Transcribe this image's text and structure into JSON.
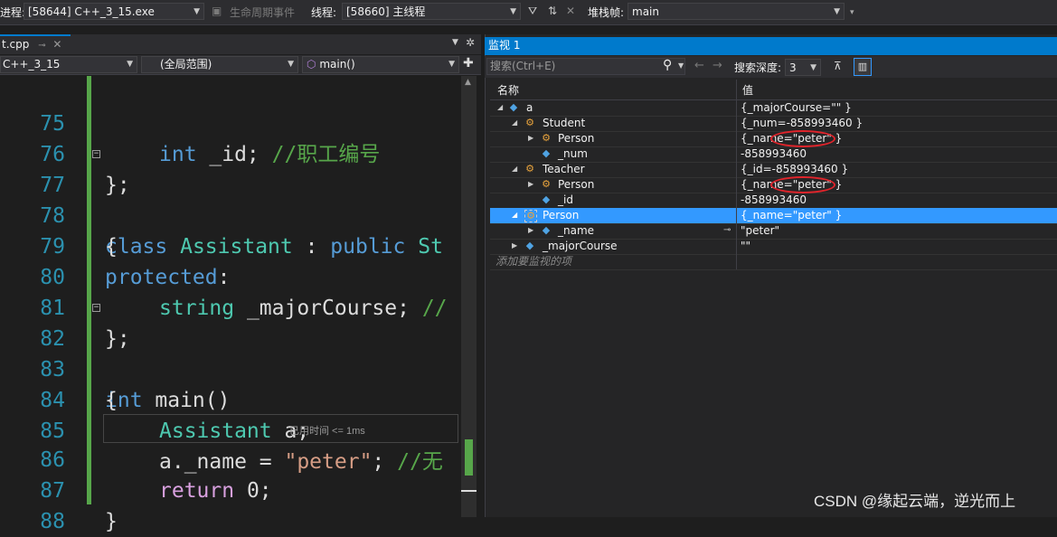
{
  "toolbar": {
    "process_label": "进程:",
    "process_value": "[58644] C++_3_15.exe",
    "lifecycle_label": "生命周期事件",
    "thread_label": "线程:",
    "thread_value": "[58660] 主线程",
    "stackframe_label": "堆栈帧:",
    "stackframe_value": "main"
  },
  "editor": {
    "tab_name": "t.cpp",
    "nav_project": "C++_3_15",
    "nav_scope": "(全局范围)",
    "nav_function": "main()",
    "perf_tip": "已用时间 <= 1ms",
    "lines": [
      {
        "num": "75"
      },
      {
        "num": "76"
      },
      {
        "num": "77"
      },
      {
        "num": "78"
      },
      {
        "num": "79"
      },
      {
        "num": "80"
      },
      {
        "num": "81"
      },
      {
        "num": "82"
      },
      {
        "num": "83"
      },
      {
        "num": "84"
      },
      {
        "num": "85"
      },
      {
        "num": "86"
      },
      {
        "num": "87"
      },
      {
        "num": "88"
      }
    ],
    "code": {
      "l75_kw": "int",
      "l75_text": " _id; ",
      "l75_comment": "//职工编号",
      "l76": "};",
      "l77_kw": "class",
      "l77_type": "Assistant",
      "l77_colon": " : ",
      "l77_public": "public",
      "l77_rest": "St",
      "l78": "{",
      "l79_kw": "protected",
      "l79_colon": ":",
      "l80_type": "string",
      "l80_text": " _majorCourse; ",
      "l80_comment": "//",
      "l81": "};",
      "l82_kw": "int",
      "l82_text": " main()",
      "l83": "{",
      "l84_type": "Assistant",
      "l84_text": " a;",
      "l85_text": "a._name = ",
      "l85_str": "\"peter\"",
      "l85_semi": "; ",
      "l85_comment": "//无",
      "l86_kw": "return",
      "l86_text": " 0;",
      "l87": "}"
    }
  },
  "watch": {
    "title": "监视 1",
    "search_placeholder": "搜索(Ctrl+E)",
    "depth_label": "搜索深度:",
    "depth_value": "3",
    "col_name": "名称",
    "col_value": "值",
    "rows": [
      {
        "name": "a",
        "value": "{_majorCourse=\"\" }"
      },
      {
        "name": "Student",
        "value": "{_num=-858993460 }"
      },
      {
        "name": "Person",
        "value": "{_name=\"peter\" }"
      },
      {
        "name": "_num",
        "value": "-858993460"
      },
      {
        "name": "Teacher",
        "value": "{_id=-858993460 }"
      },
      {
        "name": "Person",
        "value": "{_name=\"peter\" }"
      },
      {
        "name": "_id",
        "value": "-858993460"
      },
      {
        "name": "Person",
        "value": "{_name=\"peter\" }"
      },
      {
        "name": "_name",
        "value": "\"peter\""
      },
      {
        "name": "_majorCourse",
        "value": "\"\""
      }
    ],
    "add_watch": "添加要监视的项"
  },
  "watermark": "CSDN @缘起云端，逆光而上",
  "colors": {
    "accent": "#007acc",
    "selection": "#3399ff",
    "annotation": "#e0242b"
  }
}
